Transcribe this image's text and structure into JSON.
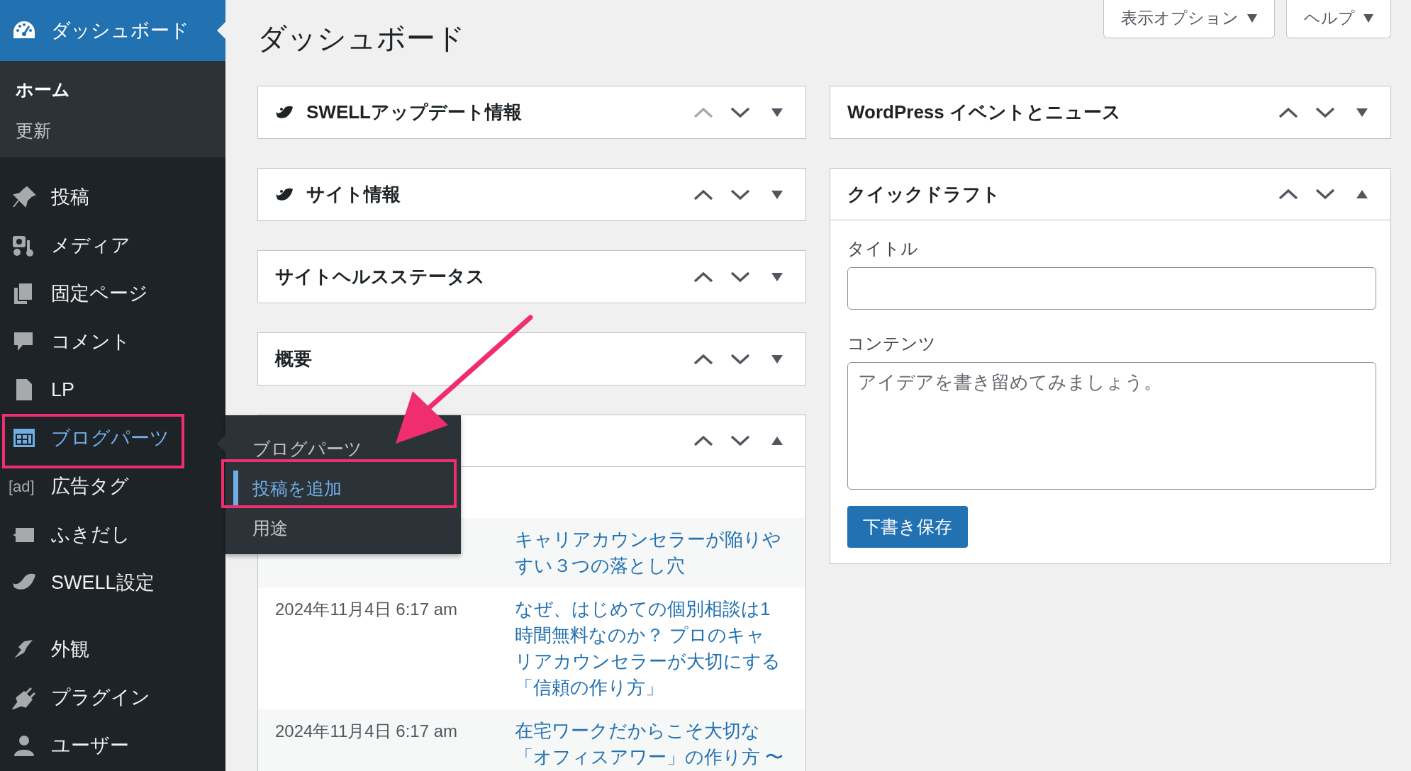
{
  "sidebar": {
    "current": {
      "label": "ダッシュボード",
      "submenu": [
        {
          "label": "ホーム",
          "selected": true
        },
        {
          "label": "更新",
          "selected": false
        }
      ]
    },
    "sections": [
      {
        "items": [
          {
            "label": "投稿",
            "selected": false
          },
          {
            "label": "メディア",
            "selected": false
          },
          {
            "label": "固定ページ",
            "selected": false
          },
          {
            "label": "コメント",
            "selected": false
          },
          {
            "label": "LP",
            "selected": false
          },
          {
            "label": "ブログパーツ",
            "selected": true
          },
          {
            "label": "広告タグ",
            "icon_text": "[ad]",
            "selected": false
          },
          {
            "label": "ふきだし",
            "selected": false
          },
          {
            "label": "SWELL設定",
            "selected": false
          }
        ]
      },
      {
        "items": [
          {
            "label": "外観",
            "selected": false
          },
          {
            "label": "プラグイン",
            "selected": false
          },
          {
            "label": "ユーザー",
            "selected": false
          }
        ]
      }
    ]
  },
  "flyout": {
    "items": [
      {
        "label": "ブログパーツ",
        "selected": false
      },
      {
        "label": "投稿を追加",
        "selected": true
      },
      {
        "label": "用途",
        "selected": false
      }
    ]
  },
  "header": {
    "title": "ダッシュボード",
    "buttons": [
      "表示オプション",
      "ヘルプ"
    ]
  },
  "columns": [
    {
      "panels": [
        {
          "title": "SWELLアップデート情報",
          "kind": "swell",
          "up_disabled": true,
          "expanded": false
        },
        {
          "title": "サイト情報",
          "kind": "swell",
          "up_disabled": false,
          "expanded": false
        },
        {
          "title": "サイトヘルスステータス",
          "kind": "plain",
          "up_disabled": false,
          "expanded": false
        },
        {
          "title": "概要",
          "kind": "plain",
          "up_disabled": false,
          "expanded": false
        },
        {
          "kind": "plain",
          "up_disabled": false,
          "expanded": true,
          "rows": [
            {
              "link": "キャリアカウンセラーが陥りやすい３つの落とし穴"
            },
            {
              "date": "2024年11月4日 6:17 am",
              "link": "なぜ、はじめての個別相談は1時間無料なのか？ プロのキャリアカウンセラーが大切にする「信頼の作り方」"
            },
            {
              "date": "2024年11月4日 6:17 am",
              "link": "在宅ワークだからこそ大切な「オフィスアワー」の作り方 〜"
            }
          ]
        }
      ]
    },
    {
      "panels": [
        {
          "title": "WordPress イベントとニュース",
          "kind": "plain",
          "up_disabled": false,
          "expanded": false
        },
        {
          "title": "クイックドラフト",
          "kind": "plain",
          "up_disabled": false,
          "expanded": true,
          "form": {
            "title_label": "タイトル",
            "content_label": "コンテンツ",
            "content_placeholder": "アイデアを書き留めてみましょう。",
            "button": "下書き保存"
          }
        }
      ]
    }
  ]
}
